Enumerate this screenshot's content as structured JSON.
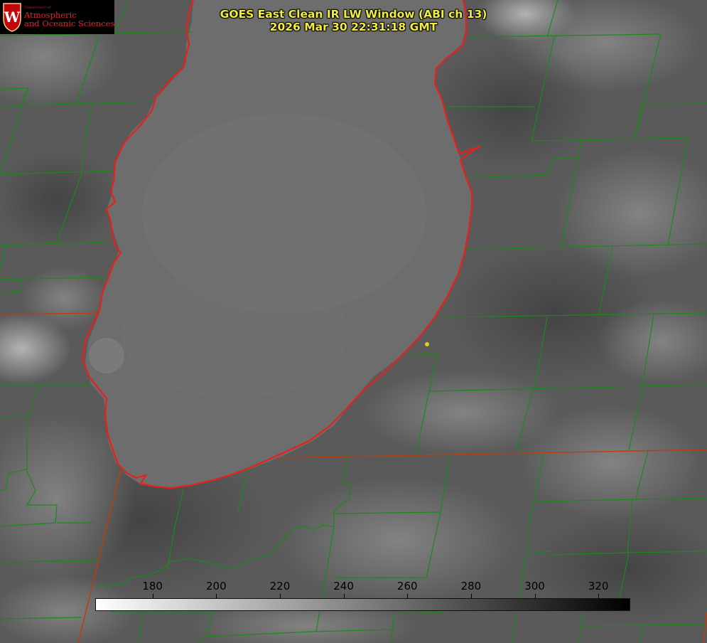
{
  "title": {
    "line1": "GOES East Clean IR LW Window (ABI ch 13)",
    "line2": "2026 Mar 30 22:31:18 GMT"
  },
  "logo": {
    "department": "Department of",
    "line1": "Atmospheric",
    "line2": "and Oceanic Sciences",
    "seal_letter": "W"
  },
  "colorbar": {
    "min": 162,
    "max": 330,
    "ticks": [
      "180",
      "200",
      "220",
      "240",
      "260",
      "280",
      "300",
      "320"
    ],
    "tick_values": [
      180,
      200,
      220,
      240,
      260,
      280,
      300,
      320
    ],
    "gradient_from": "#ffffff",
    "gradient_to": "#000000"
  },
  "colors": {
    "title_text": "#f2ec3a",
    "coastline": "#e8201a",
    "county_borders": "#1a8a1a",
    "state_borders": "#b84010",
    "marker": "#e0d020",
    "lake": "#6e6e6e",
    "land": "#5a5a5a"
  },
  "map": {
    "feature": "lake",
    "marker_icon": "station-dot-icon"
  }
}
